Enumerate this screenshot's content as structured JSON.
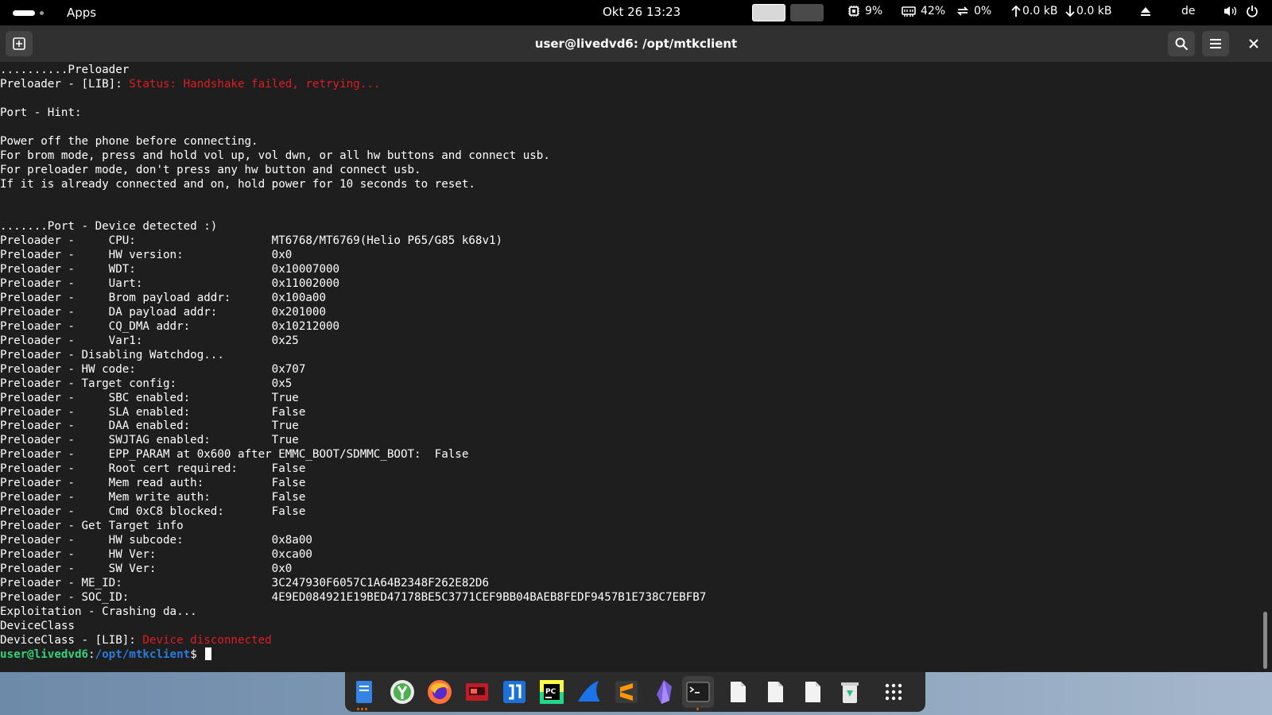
{
  "topbar": {
    "apps_label": "Apps",
    "clock": "Okt 26  13:23",
    "cpu": "9%",
    "mem": "42%",
    "swap": "0%",
    "net_up": "0.0 kB",
    "net_down": "0.0 kB",
    "keyboard_layout": "de"
  },
  "window": {
    "title": "user@livedvd6: /opt/mtkclient"
  },
  "terminal": {
    "lines": [
      "..........Preloader",
      "Preloader - [LIB]: ",
      "",
      "Port - Hint:",
      "",
      "Power off the phone before connecting.",
      "For brom mode, press and hold vol up, vol dwn, or all hw buttons and connect usb.",
      "For preloader mode, don't press any hw button and connect usb.",
      "If it is already connected and on, hold power for 10 seconds to reset.",
      "",
      "",
      ".......Port - Device detected :)",
      "Preloader -     CPU:                    MT6768/MT6769(Helio P65/G85 k68v1)",
      "Preloader -     HW version:             0x0",
      "Preloader -     WDT:                    0x10007000",
      "Preloader -     Uart:                   0x11002000",
      "Preloader -     Brom payload addr:      0x100a00",
      "Preloader -     DA payload addr:        0x201000",
      "Preloader -     CQ_DMA addr:            0x10212000",
      "Preloader -     Var1:                   0x25",
      "Preloader - Disabling Watchdog...",
      "Preloader - HW code:                    0x707",
      "Preloader - Target config:              0x5",
      "Preloader -     SBC enabled:            True",
      "Preloader -     SLA enabled:            False",
      "Preloader -     DAA enabled:            True",
      "Preloader -     SWJTAG enabled:         True",
      "Preloader -     EPP_PARAM at 0x600 after EMMC_BOOT/SDMMC_BOOT:  False",
      "Preloader -     Root cert required:     False",
      "Preloader -     Mem read auth:          False",
      "Preloader -     Mem write auth:         False",
      "Preloader -     Cmd 0xC8 blocked:       False",
      "Preloader - Get Target info",
      "Preloader -     HW subcode:             0x8a00",
      "Preloader -     HW Ver:                 0xca00",
      "Preloader -     SW Ver:                 0x0",
      "Preloader - ME_ID:                      3C247930F6057C1A64B2348F262E82D6",
      "Preloader - SOC_ID:                     4E9ED084921E19BED47178BE5C3771CEF9BB04BAEB8FEDF9457B1E738C7EBFB7",
      "Exploitation - Crashing da...",
      "DeviceClass",
      "DeviceClass - [LIB]: "
    ],
    "red_status_1": "Status: Handshake failed, retrying...",
    "red_status_2": "Device disconnected",
    "prompt_user": "user@livedvd6",
    "prompt_sep": ":",
    "prompt_path": "/opt/mtkclient",
    "prompt_symbol": "$ "
  },
  "dock": {
    "apps": [
      "file-manager",
      "xfburn",
      "firefox",
      "gparted",
      "jdownloader",
      "pycharm",
      "wireshark",
      "sublime-text",
      "obsidian",
      "terminal",
      "document-1",
      "document-2",
      "document-3",
      "trash"
    ]
  },
  "colors": {
    "error_red": "#e01b24",
    "prompt_green": "#33d17a",
    "prompt_blue": "#2a7bde",
    "terminal_bg": "#1e1e1e",
    "header_bg": "#303030"
  }
}
